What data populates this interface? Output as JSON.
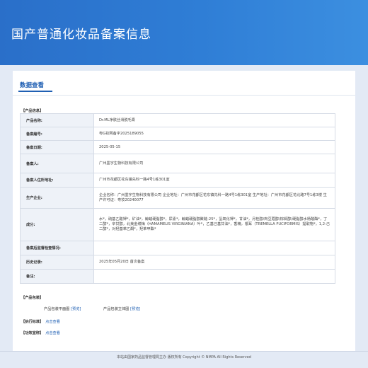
{
  "header": {
    "title": "国产普通化妆品备案信息"
  },
  "tab": {
    "label": "数据查看"
  },
  "product_section": {
    "heading": "【产品信息】",
    "rows": [
      {
        "label": "产品名称:",
        "value": "Dr.ML净肤丝滑脱毛膏"
      },
      {
        "label": "备案编号:",
        "value": "粤G妆网备字2025189055"
      },
      {
        "label": "备案日期:",
        "value": "2025-05-15"
      },
      {
        "label": "备案人:",
        "value": "广州墨宇生物科技有限公司"
      },
      {
        "label": "备案人住所地址:",
        "value": "广州市花都区花东镇先科一路4号1栋301室"
      },
      {
        "label": "生产企业:",
        "value": "企业名称：广州墨宇生物科技有限公司 企业地址：广州市花都区花东镇先科一路4号1栋301室 生产地址：广州市花都区花北路7号1栋3楼 生产许可证：粤妆20240077"
      },
      {
        "label": "成分:",
        "value": "水*，硫基乙酸钾*，矿油*，鲸蜡硬脂醇*，尿素*，鲸蜡硬脂醇聚醚-25*，氢氧化钾*，甘油*，月桂醇/肉豆蔻醇/棕榈醇/硬脂醇水杨酸酯*，丁二醇*，辛甘醇，北美金缕梅（HAMAMELIS VIRGINIANA）叶*，乙基己基甘油*，香精，银耳（TREMELLA FUCIFORMIS）提取物*，1,2-己二醇*，对羟基苯乙酮*，羟苯甲酯*"
      },
      {
        "label": "备案后监督检查情况:",
        "value": ""
      },
      {
        "label": "历史记录:",
        "value": "2025年05月20日 首次备案"
      },
      {
        "label": "备注:",
        "value": ""
      }
    ]
  },
  "packaging": {
    "heading": "【产品包装】",
    "plane_label": "产品包装平面图",
    "plane_link": "[预览]",
    "solid_label": "产品包装立体图",
    "solid_link": "[预览]"
  },
  "standard": {
    "label": "【执行标准】",
    "link": "点击查看"
  },
  "efficacy": {
    "label": "【功效宣称】",
    "link": "点击查看"
  },
  "footer": {
    "text": "本站由国家药品监督管理局主办 版权所有 Copyright © NMPA All Rights Reserved"
  }
}
